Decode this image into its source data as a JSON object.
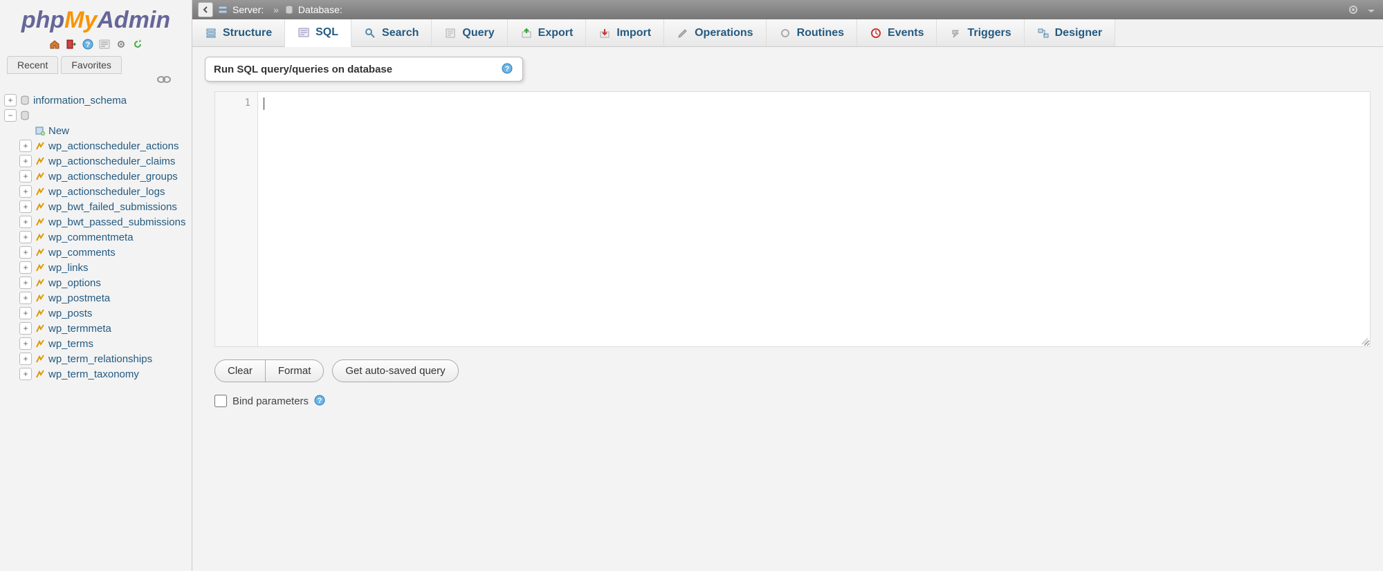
{
  "logo": {
    "p1": "php",
    "p2": "My",
    "p3": "Admin"
  },
  "sidebar": {
    "tabs": {
      "recent": "Recent",
      "favorites": "Favorites"
    },
    "databases": [
      {
        "name": "information_schema",
        "expanded": false
      }
    ],
    "current_db": {
      "new": "New",
      "tables": [
        "wp_actionscheduler_actions",
        "wp_actionscheduler_claims",
        "wp_actionscheduler_groups",
        "wp_actionscheduler_logs",
        "wp_bwt_failed_submissions",
        "wp_bwt_passed_submissions",
        "wp_commentmeta",
        "wp_comments",
        "wp_links",
        "wp_options",
        "wp_postmeta",
        "wp_posts",
        "wp_termmeta",
        "wp_terms",
        "wp_term_relationships",
        "wp_term_taxonomy"
      ]
    }
  },
  "breadcrumb": {
    "server_label": "Server:",
    "server_value": "",
    "sep": "»",
    "database_label": "Database:",
    "database_value": ""
  },
  "tabs": [
    {
      "label": "Structure",
      "active": false
    },
    {
      "label": "SQL",
      "active": true
    },
    {
      "label": "Search",
      "active": false
    },
    {
      "label": "Query",
      "active": false
    },
    {
      "label": "Export",
      "active": false
    },
    {
      "label": "Import",
      "active": false
    },
    {
      "label": "Operations",
      "active": false
    },
    {
      "label": "Routines",
      "active": false
    },
    {
      "label": "Events",
      "active": false
    },
    {
      "label": "Triggers",
      "active": false
    },
    {
      "label": "Designer",
      "active": false
    }
  ],
  "panel": {
    "title": "Run SQL query/queries on database"
  },
  "editor": {
    "line_number": "1",
    "content": ""
  },
  "buttons": {
    "clear": "Clear",
    "format": "Format",
    "get_autosaved": "Get auto-saved query"
  },
  "bind_params": {
    "label": "Bind parameters",
    "checked": false
  }
}
